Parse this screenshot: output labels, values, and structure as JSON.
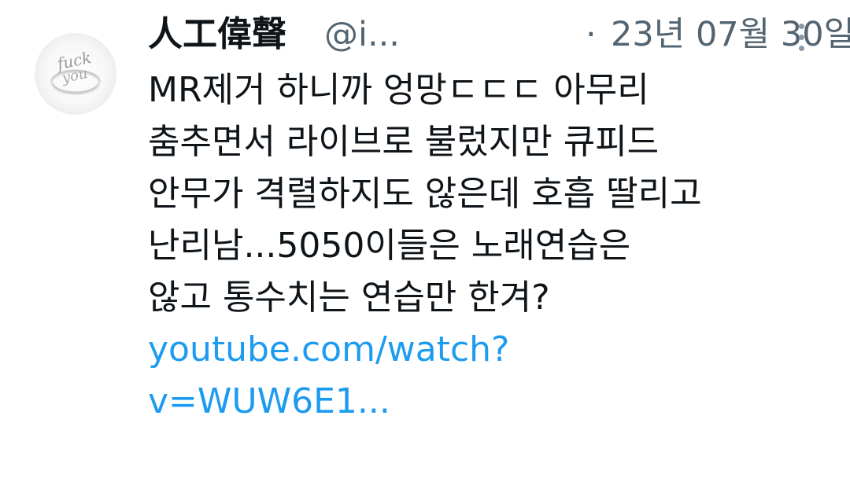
{
  "tweet": {
    "display_name": "人工偉聲",
    "handle": "@i...",
    "separator": "·",
    "date": "23년 07월 30일",
    "avatar_text": [
      "fuck",
      "you"
    ],
    "text_lines": [
      "MR제거 하니까 엉망ㄷㄷㄷ 아무리",
      "춤추면서 라이브로 불렀지만 큐피드",
      "안무가 격렬하지도 않은데 호흡 딸리고",
      "난리남...5050이들은 노래연습은",
      "않고 통수치는 연습만 한겨?"
    ],
    "link_lines": [
      "youtube.com/watch?",
      "v=WUW6E1..."
    ],
    "link_color": "#1d9bf0",
    "more_icon": "more-vertical-icon"
  }
}
